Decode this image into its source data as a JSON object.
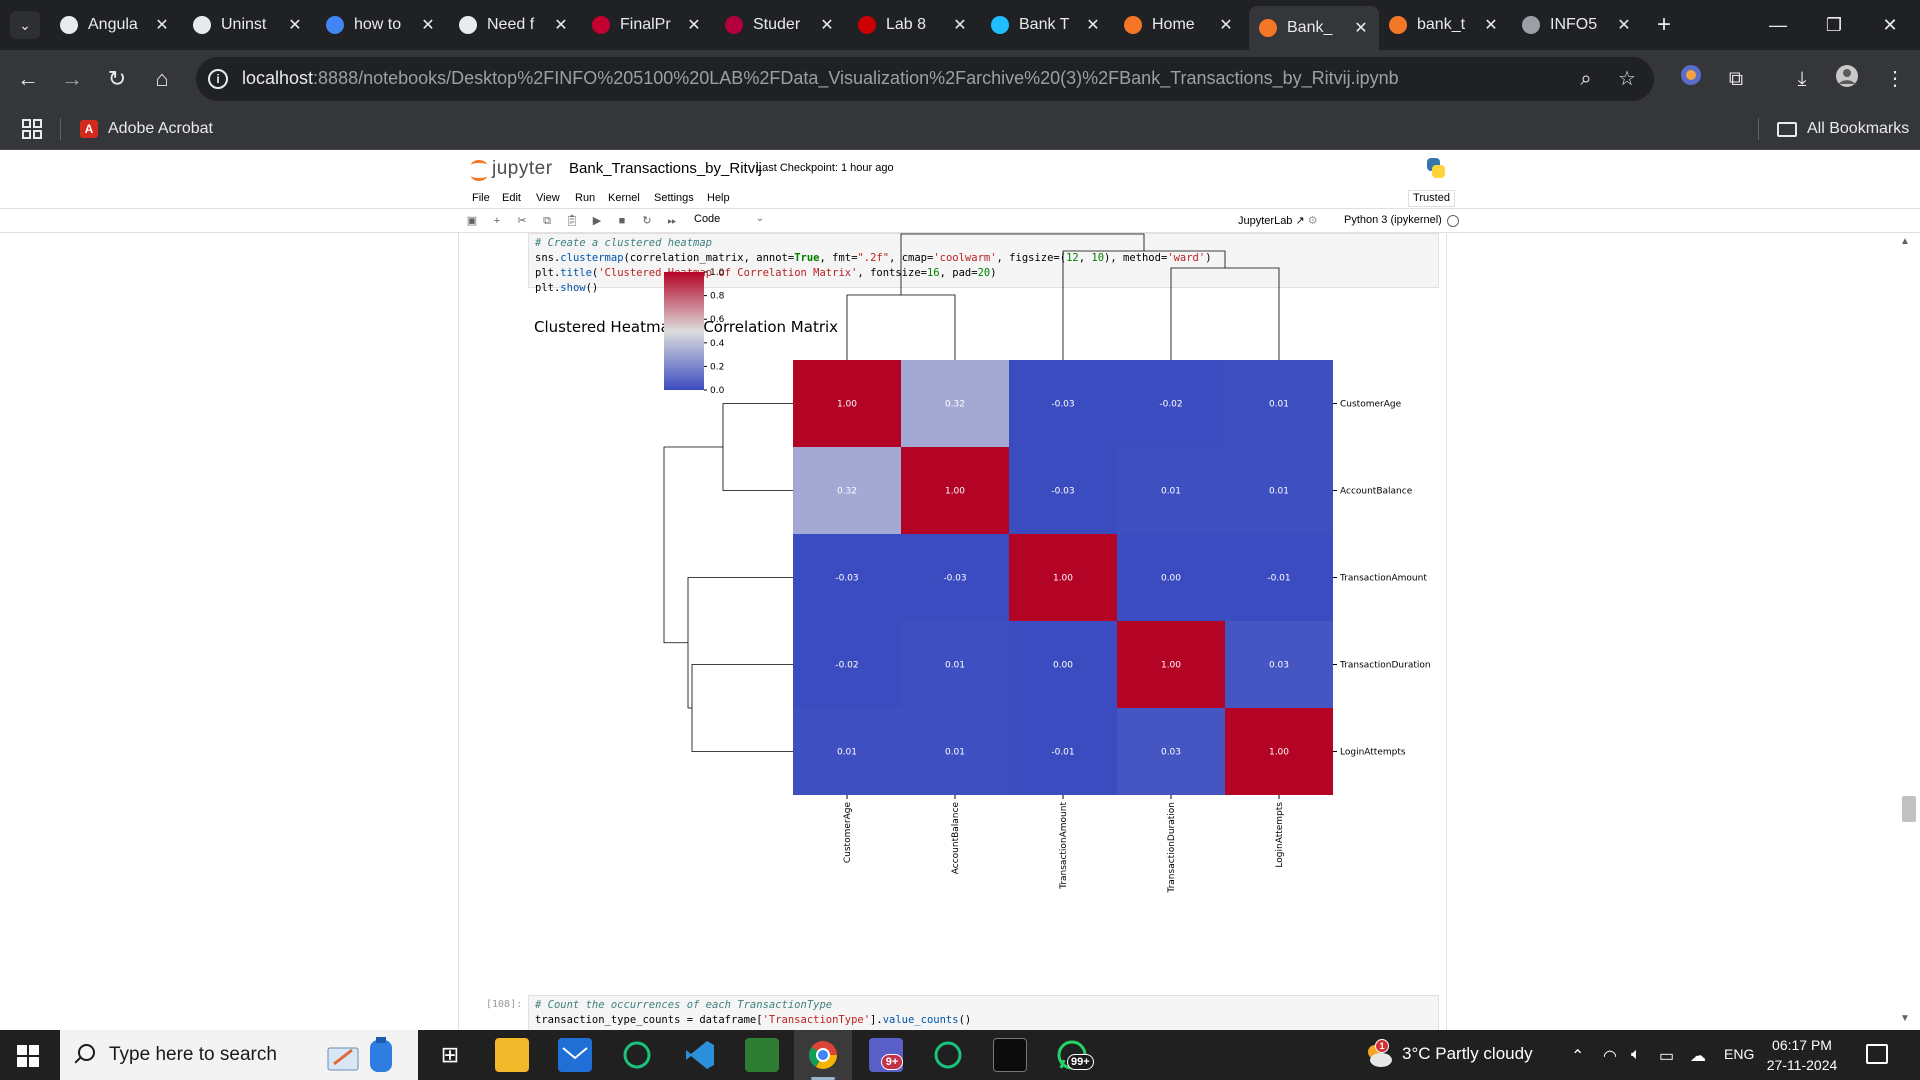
{
  "browser": {
    "tabs": [
      {
        "title": "Angula",
        "favicon": "chatgpt-icon",
        "color": "#e8eaed"
      },
      {
        "title": "Uninst",
        "favicon": "chatgpt-icon",
        "color": "#e8eaed"
      },
      {
        "title": "how to",
        "favicon": "google-icon",
        "color": "#4285f4"
      },
      {
        "title": "Need f",
        "favicon": "chatgpt-icon",
        "color": "#e8eaed"
      },
      {
        "title": "FinalPr",
        "favicon": "angular-icon",
        "color": "#c3002f"
      },
      {
        "title": "Studer",
        "favicon": "studocu-icon",
        "color": "#b3003c"
      },
      {
        "title": "Lab 8",
        "favicon": "northeastern-icon",
        "color": "#cc0000"
      },
      {
        "title": "Bank T",
        "favicon": "kaggle-icon",
        "color": "#20beff"
      },
      {
        "title": "Home",
        "favicon": "jupyter-icon",
        "color": "#f37726"
      },
      {
        "title": "Bank_",
        "favicon": "notebook-icon",
        "color": "#f37726"
      },
      {
        "title": "bank_t",
        "favicon": "file-icon",
        "color": "#f37726"
      },
      {
        "title": "INFO5",
        "favicon": "github-icon",
        "color": "#9aa0a6"
      }
    ],
    "new_tab": "+",
    "url_host": "localhost",
    "url_rest": ":8888/notebooks/Desktop%2FINFO%205100%20LAB%2FData_Visualization%2Farchive%20(3)%2FBank_Transactions_by_Ritvij.ipynb",
    "bookmark_acrobat": "Adobe Acrobat",
    "bookmark_all": "All Bookmarks"
  },
  "jupyter": {
    "logo_text": "jupyter",
    "notebook_name": "Bank_Transactions_by_Ritvij",
    "checkpoint": "Last Checkpoint: 1 hour ago",
    "menu": [
      "File",
      "Edit",
      "View",
      "Run",
      "Kernel",
      "Settings",
      "Help"
    ],
    "trusted": "Trusted",
    "cell_type": "Code",
    "jupyterlab_link": "JupyterLab",
    "kernel": "Python 3 (ipykernel)",
    "cell1_code": {
      "comment": "# Create a clustered heatmap",
      "line2_a": "sns.",
      "line2_fn": "clustermap",
      "line2_b": "(correlation_matrix, annot=",
      "line2_true": "True",
      "line2_c": ", fmt=",
      "line2_fmt": "\".2f\"",
      "line2_d": ", cmap=",
      "line2_cmap": "'coolwarm'",
      "line2_e": ", figsize=(",
      "line2_n1": "12",
      "line2_f": ", ",
      "line2_n2": "10",
      "line2_g": "), method=",
      "line2_method": "'ward'",
      "line2_h": ")",
      "line3_a": "plt.",
      "line3_fn": "title",
      "line3_b": "(",
      "line3_str": "'Clustered Heatmap of Correlation Matrix'",
      "line3_c": ", fontsize=",
      "line3_n1": "16",
      "line3_d": ", pad=",
      "line3_n2": "20",
      "line3_e": ")",
      "line4_a": "plt.",
      "line4_fn": "show",
      "line4_b": "()"
    },
    "cell2_prompt": "[108]:",
    "cell2_code": {
      "comment": "# Count the occurrences of each TransactionType",
      "line2_a": "transaction_type_counts = dataframe[",
      "line2_str": "'TransactionType'",
      "line2_b": "].",
      "line2_fn": "value_counts",
      "line2_c": "()"
    }
  },
  "chart_data": {
    "type": "heatmap",
    "title": "Clustered Heatmap of Correlation Matrix",
    "rows": [
      "CustomerAge",
      "AccountBalance",
      "TransactionAmount",
      "TransactionDuration",
      "LoginAttempts"
    ],
    "cols": [
      "CustomerAge",
      "AccountBalance",
      "TransactionAmount",
      "TransactionDuration",
      "LoginAttempts"
    ],
    "values": [
      [
        1.0,
        0.32,
        -0.03,
        -0.02,
        0.01
      ],
      [
        0.32,
        1.0,
        -0.03,
        0.01,
        0.01
      ],
      [
        -0.03,
        -0.03,
        1.0,
        0.0,
        -0.01
      ],
      [
        -0.02,
        0.01,
        0.0,
        1.0,
        0.03
      ],
      [
        0.01,
        0.01,
        -0.01,
        0.03,
        1.0
      ]
    ],
    "colorbar": {
      "ticks": [
        "1.0",
        "0.8",
        "0.6",
        "0.4",
        "0.2",
        "0.0"
      ],
      "range": [
        0.0,
        1.0
      ],
      "cmap": "coolwarm"
    },
    "colors": {
      "low": "#3b4cc0",
      "mid": "#dddddd",
      "high": "#b40426"
    },
    "dendrograms": "row dendrogram on left, column dendrogram on top"
  },
  "taskbar": {
    "search_placeholder": "Type here to search",
    "weather": "3°C  Partly cloudy",
    "weather_badge": "1",
    "lang": "ENG",
    "time": "06:17 PM",
    "date": "27-11-2024",
    "teams_badge": "9+",
    "whatsapp_badge": "99+"
  }
}
